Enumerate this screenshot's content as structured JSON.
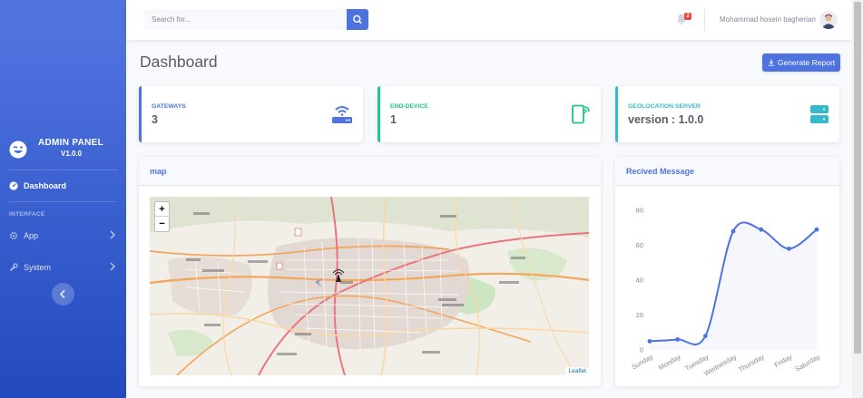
{
  "sidebar": {
    "brand_title": "ADMIN PANEL",
    "brand_version": "V1.0.0",
    "items": [
      {
        "label": "Dashboard",
        "icon": "tachometer-icon"
      },
      {
        "label": "App",
        "icon": "cog-icon"
      },
      {
        "label": "System",
        "icon": "wrench-icon"
      }
    ],
    "heading": "INTERFACE"
  },
  "topbar": {
    "search_placeholder": "Search for...",
    "notification_count": "2",
    "user_name": "Mohammad hosein bagherian"
  },
  "page": {
    "title": "Dashboard",
    "generate_button": "Generate Report"
  },
  "stats": [
    {
      "label": "GATEWAYS",
      "value": "3",
      "color": "#4e73df",
      "icon": "router-icon"
    },
    {
      "label": "END-DEVICE",
      "value": "1",
      "color": "#1cc88a",
      "icon": "device-signal-icon"
    },
    {
      "label": "GEOLOCATION SERVER",
      "value": "version : 1.0.0",
      "color": "#36b9cc",
      "icon": "server-icon"
    }
  ],
  "map_card": {
    "title": "map",
    "attribution": "Leaflet",
    "zoom_in": "+",
    "zoom_out": "−"
  },
  "chart_card": {
    "title": "Recived Message"
  },
  "chart_data": {
    "type": "line",
    "categories": [
      "Sunday",
      "Monday",
      "Tuesday",
      "Wednesday",
      "Thursday",
      "Friday",
      "Saturday"
    ],
    "series": [
      {
        "values": [
          5,
          6,
          8,
          68,
          69,
          58,
          69
        ],
        "color": "#4e73df"
      }
    ],
    "y_ticks": [
      0,
      20,
      40,
      60,
      80
    ],
    "ylim": [
      0,
      80
    ],
    "grid": false
  }
}
